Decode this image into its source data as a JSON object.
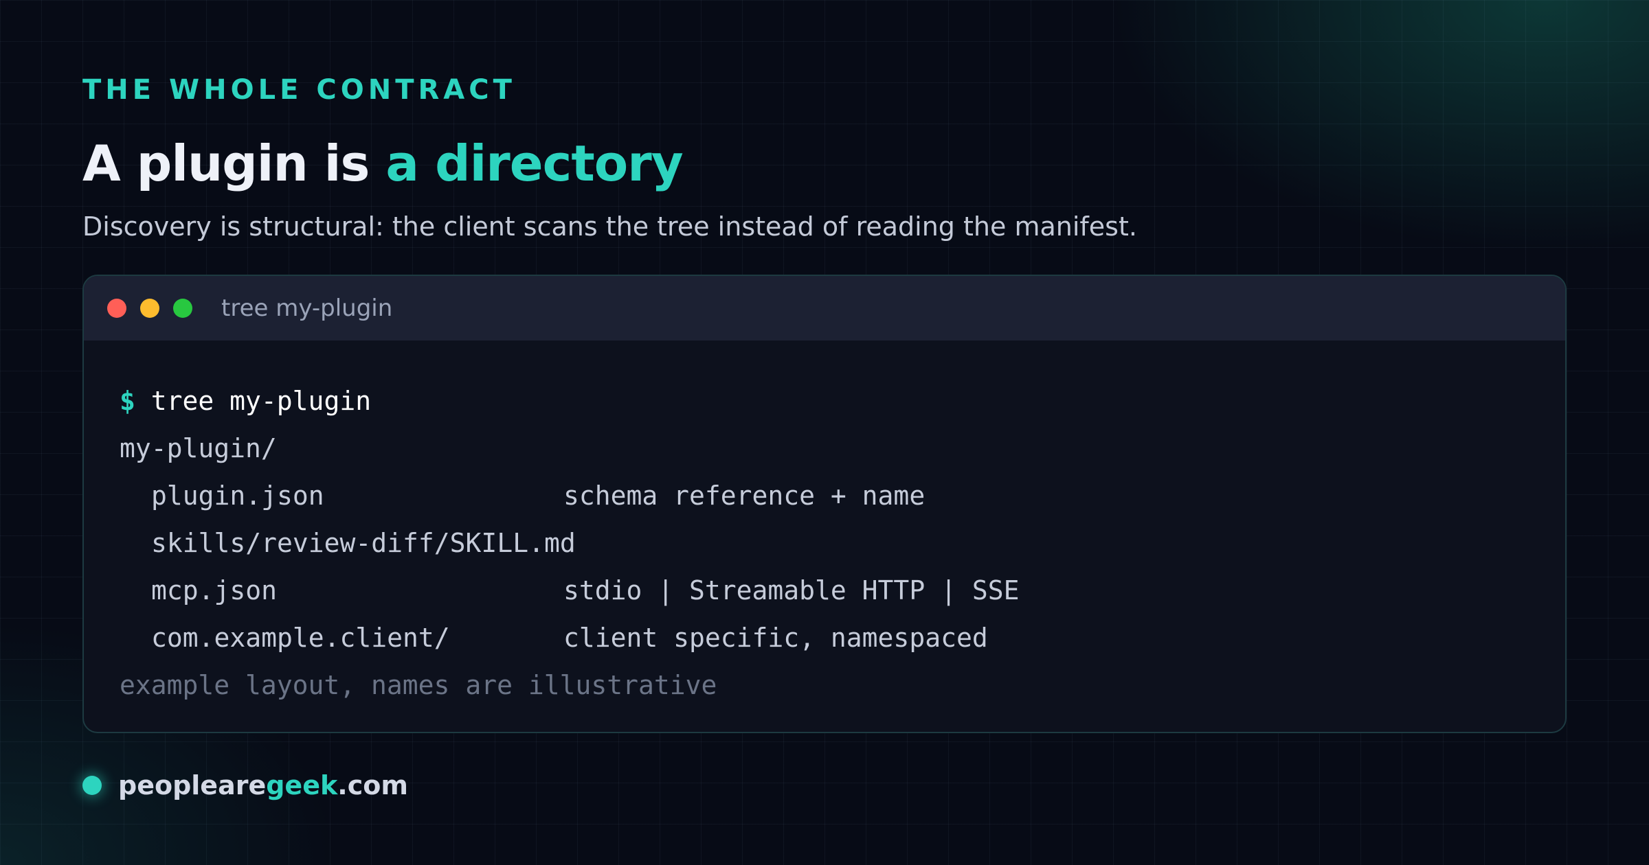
{
  "header": {
    "eyebrow": "THE WHOLE CONTRACT",
    "title_main": "A plugin is ",
    "title_accent": "a directory",
    "subtitle": "Discovery is structural: the client scans the tree instead of reading the manifest."
  },
  "terminal": {
    "window_title": "tree my-plugin",
    "prompt_symbol": "$",
    "command": "tree my-plugin",
    "root": "my-plugin/",
    "entries": [
      {
        "path": "plugin.json",
        "comment": "schema reference + name"
      },
      {
        "path": "skills/review-diff/SKILL.md",
        "comment": ""
      },
      {
        "path": "mcp.json",
        "comment": "stdio | Streamable HTTP | SSE"
      },
      {
        "path": "com.example.client/",
        "comment": "client specific, namespaced"
      }
    ],
    "footnote": "example layout, names are illustrative"
  },
  "footer": {
    "brand_prefix": "peopleare",
    "brand_highlight": "geek",
    "brand_suffix": ".com"
  },
  "colors": {
    "accent": "#2dd4bf",
    "background": "#070b16",
    "terminal_bar": "#1c2133",
    "terminal_body": "#0d111d",
    "dot_red": "#ff5f57",
    "dot_yellow": "#febc2e",
    "dot_green": "#28c840"
  }
}
